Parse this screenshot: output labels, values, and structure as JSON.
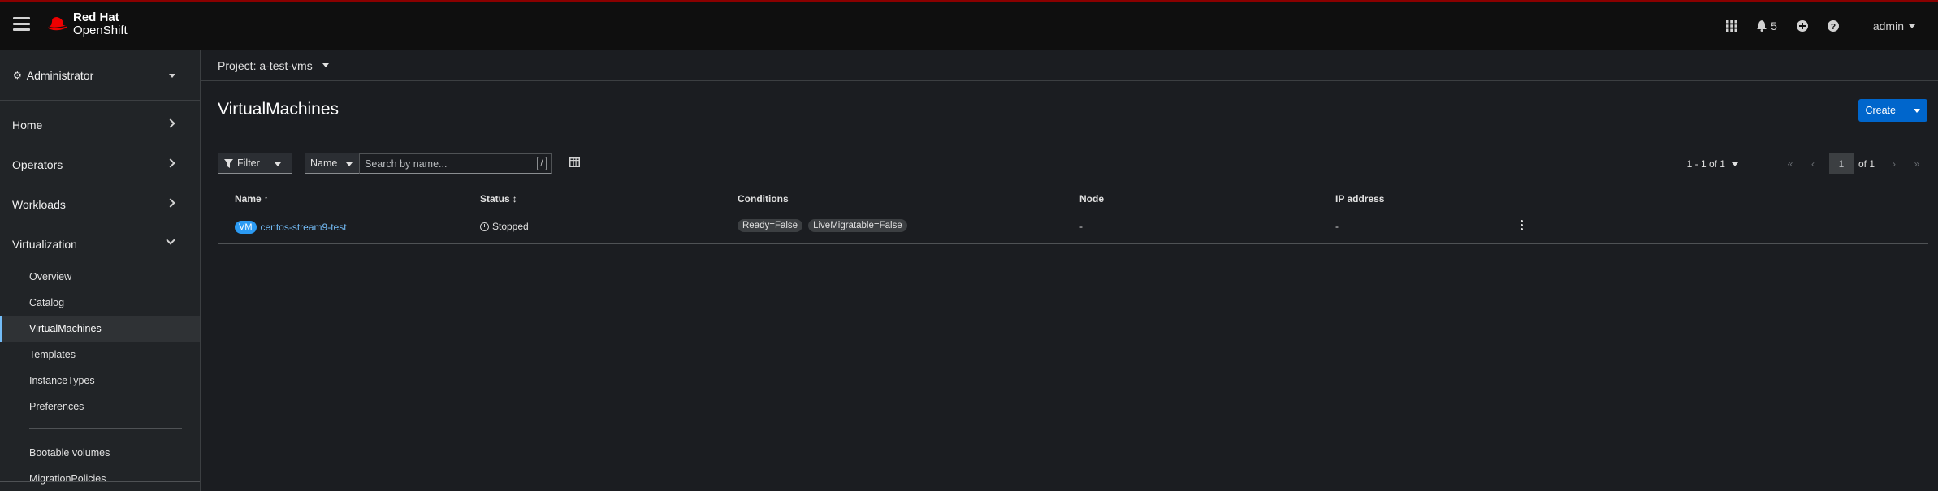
{
  "masthead": {
    "brand_line1": "Red Hat",
    "brand_line2": "OpenShift",
    "notification_count": "5",
    "user": "admin",
    "icons": [
      "grid-icon",
      "bell-icon",
      "plus-circle-icon",
      "help-icon"
    ],
    "border_color": "#8a0000"
  },
  "sidebar": {
    "perspective": "Administrator",
    "sections": [
      {
        "label": "Home"
      },
      {
        "label": "Operators"
      },
      {
        "label": "Workloads"
      },
      {
        "label": "Virtualization"
      }
    ],
    "virt_items": [
      {
        "label": "Overview"
      },
      {
        "label": "Catalog"
      },
      {
        "label": "VirtualMachines"
      },
      {
        "label": "Templates"
      },
      {
        "label": "InstanceTypes"
      },
      {
        "label": "Preferences"
      }
    ],
    "virt_items_extra": [
      {
        "label": "Bootable volumes"
      },
      {
        "label": "MigrationPolicies"
      }
    ],
    "active_color": "#73bcf7"
  },
  "project": {
    "label": "Project: a-test-vms"
  },
  "page": {
    "title": "VirtualMachines",
    "create_label": "Create"
  },
  "toolbar": {
    "filter_label": "Filter",
    "name_select": "Name",
    "search_placeholder": "Search by name...",
    "search_shortcut": "/"
  },
  "pagination": {
    "range": "1 - 1 of 1",
    "current_page": "1",
    "of_pages": "of 1"
  },
  "table": {
    "columns": {
      "name": "Name",
      "status": "Status",
      "conditions": "Conditions",
      "node": "Node",
      "ip": "IP address"
    },
    "rows": [
      {
        "badge": "VM",
        "name": "centos-stream9-test",
        "status": "Stopped",
        "conditions": [
          "Ready=False",
          "LiveMigratable=False"
        ],
        "node": "-",
        "ip": "-"
      }
    ]
  },
  "colors": {
    "primary": "#0066cc",
    "link": "#73bcf7",
    "vm_badge": "#2b9af3"
  }
}
